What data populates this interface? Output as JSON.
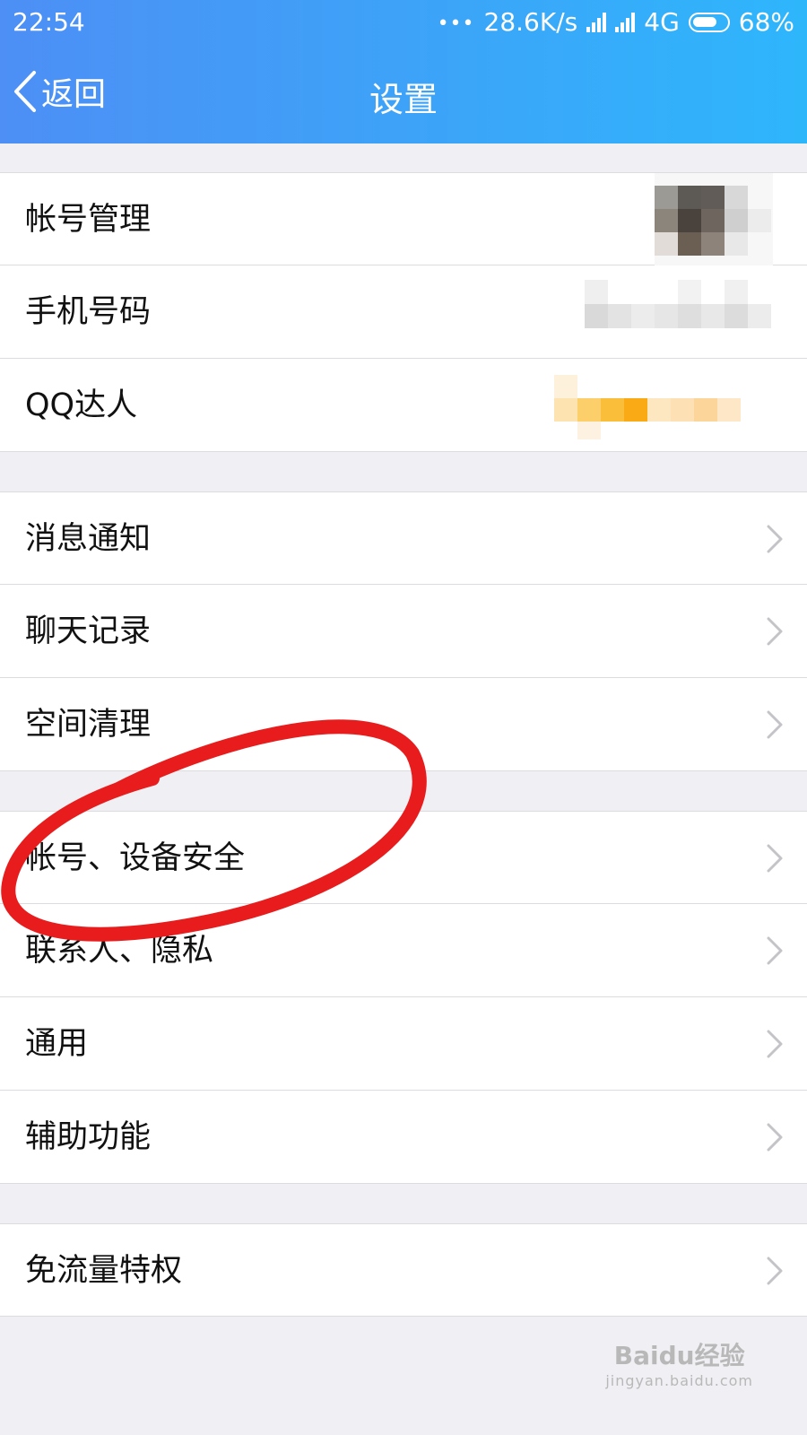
{
  "status_bar": {
    "time": "22:54",
    "dots": "•••",
    "speed": "28.6K/s",
    "network": "4G",
    "battery": "68%"
  },
  "nav": {
    "back_label": "返回",
    "title": "设置"
  },
  "colors": {
    "header_gradient_start": "#4d8ff5",
    "header_gradient_end": "#2eb6fb",
    "annotation_red": "#e81c1c"
  },
  "settings": {
    "account_management": "帐号管理",
    "phone_number": "手机号码",
    "qq_talent": "QQ达人",
    "message_notification": "消息通知",
    "chat_history": "聊天记录",
    "space_cleanup": "空间清理",
    "account_device_security": "帐号、设备安全",
    "contacts_privacy": "联系人、隐私",
    "general": "通用",
    "accessibility": "辅助功能",
    "free_data_privilege": "免流量特权"
  },
  "watermark": {
    "brand": "Baidu经验",
    "url": "jingyan.baidu.com"
  }
}
